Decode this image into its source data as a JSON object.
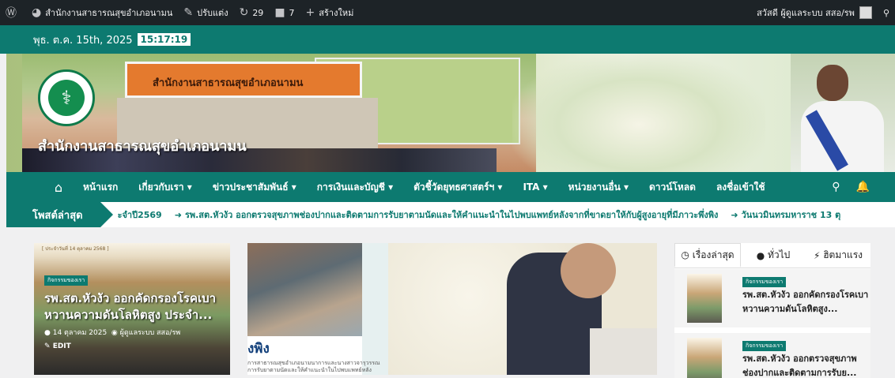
{
  "adminbar": {
    "site_name": "สำนักงานสาธารณสุขอำเภอนามน",
    "customize": "ปรับแต่ง",
    "updates": "29",
    "comments": "7",
    "new": "สร้างใหม่",
    "greeting": "สวัสดี ผู้ดูแลระบบ สสอ/รพ"
  },
  "datebar": {
    "date": "พุธ. ต.ค. 15th, 2025",
    "time": "15:17:19"
  },
  "banner": {
    "building_sign": "สำนักงานสาธารณสุขอำเภอนามน",
    "site_title": "สำนักงานสาธารณสุขอำเภอนามน"
  },
  "nav": {
    "items": [
      "หน้าแรก",
      "เกี่ยวกับเรา ▾",
      "ข่าวประชาสัมพันธ์ ▾",
      "การเงินและบัญชี ▾",
      "ตัวชี้วัดยุทธศาสตร์ฯ ▾",
      "ITA ▾",
      "หน่วยงานอื่น ▾",
      "ดาวน์โหลด",
      "ลงชื่อเข้าใช้"
    ]
  },
  "ticker": {
    "label": "โพสต์ล่าสุด",
    "items": [
      "ะจำปี2569",
      "รพ.สต.หัวงัว ออกตรวจสุขภาพช่องปากและติดตามการรับยาตามนัดและให้คำแนะนำในไปพบแพทย์หลังจากที่ขาดยาให้กับผู้สูงอายุที่มีภาวะพึ่งพิง",
      "วันนวมินทรมหาราช 13 ตุ"
    ]
  },
  "featured": {
    "doc_header": "[ ประจำวันที่ 14 ตุลาคม 2568 ]",
    "tag": "กิจกรรมของเรา",
    "title": "รพ.สต.หัวงัว ออกคัดกรองโรคเบาหวานความดันโลหิตสูง ประจำ...",
    "date": "14 ตุลาคม 2025",
    "author": "ผู้ดูแลระบบ สสอ/รพ",
    "edit": "EDIT"
  },
  "card2": {
    "big_text": "งพิง",
    "desc": "การสาธารณสุขอำเภอนามนาการและนางสาวจารุวรรณ การรับยาตามนัดและให้คำแนะนำในไปพบแพทย์หลัง"
  },
  "sidebar": {
    "tabs": [
      "เรื่องล่าสุด",
      "ทั่วไป",
      "ฮิตมาแรง"
    ],
    "posts": [
      {
        "tag": "กิจกรรมของเรา",
        "title": "รพ.สต.หัวงัว ออกคัดกรองโรคเบาหวานความดันโลหิตสูง..."
      },
      {
        "tag": "กิจกรรมของเรา",
        "title": "รพ.สต.หัวงัว ออกตรวจสุขภาพช่องปากและติดตามการรับย..."
      }
    ]
  },
  "colors": {
    "primary": "#0d7a70",
    "adminbar": "#1d2327"
  },
  "icons": [
    "wordpress-icon",
    "dashboard-icon",
    "brush-icon",
    "updates-icon",
    "comments-icon",
    "plus-icon",
    "home-icon",
    "search-icon",
    "bell-icon",
    "clock-icon",
    "fire-icon",
    "bolt-icon",
    "user-icon",
    "edit-icon"
  ]
}
